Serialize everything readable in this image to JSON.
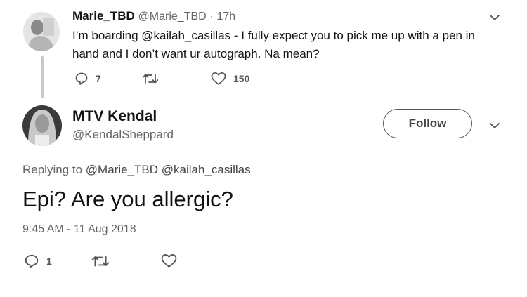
{
  "parent_tweet": {
    "display_name": "Marie_TBD",
    "handle": "@Marie_TBD",
    "separator": "·",
    "time": "17h",
    "text": "I’m boarding @kailah_casillas - I fully expect you to pick me up with a pen in hand and I don’t want ur autograph. Na mean?",
    "reply_count": "7",
    "like_count": "150",
    "icons": [
      "avatar",
      "chevron-down-icon",
      "reply-icon",
      "retweet-icon",
      "like-icon"
    ]
  },
  "reply_tweet": {
    "display_name": "MTV Kendal",
    "handle": "@KendalSheppard",
    "follow_label": "Follow",
    "replying_prefix": "Replying to",
    "replying_to": [
      "@Marie_TBD",
      "@kailah_casillas"
    ],
    "text": "Epi? Are you allergic?",
    "timestamp": "9:45 AM - 11 Aug 2018",
    "reply_count": "1",
    "icons": [
      "avatar",
      "chevron-down-icon",
      "reply-icon",
      "retweet-icon",
      "like-icon"
    ]
  },
  "colors": {
    "text": "#141414",
    "muted": "#666666",
    "icon": "#555555",
    "thread_line": "#c9c9c9"
  }
}
